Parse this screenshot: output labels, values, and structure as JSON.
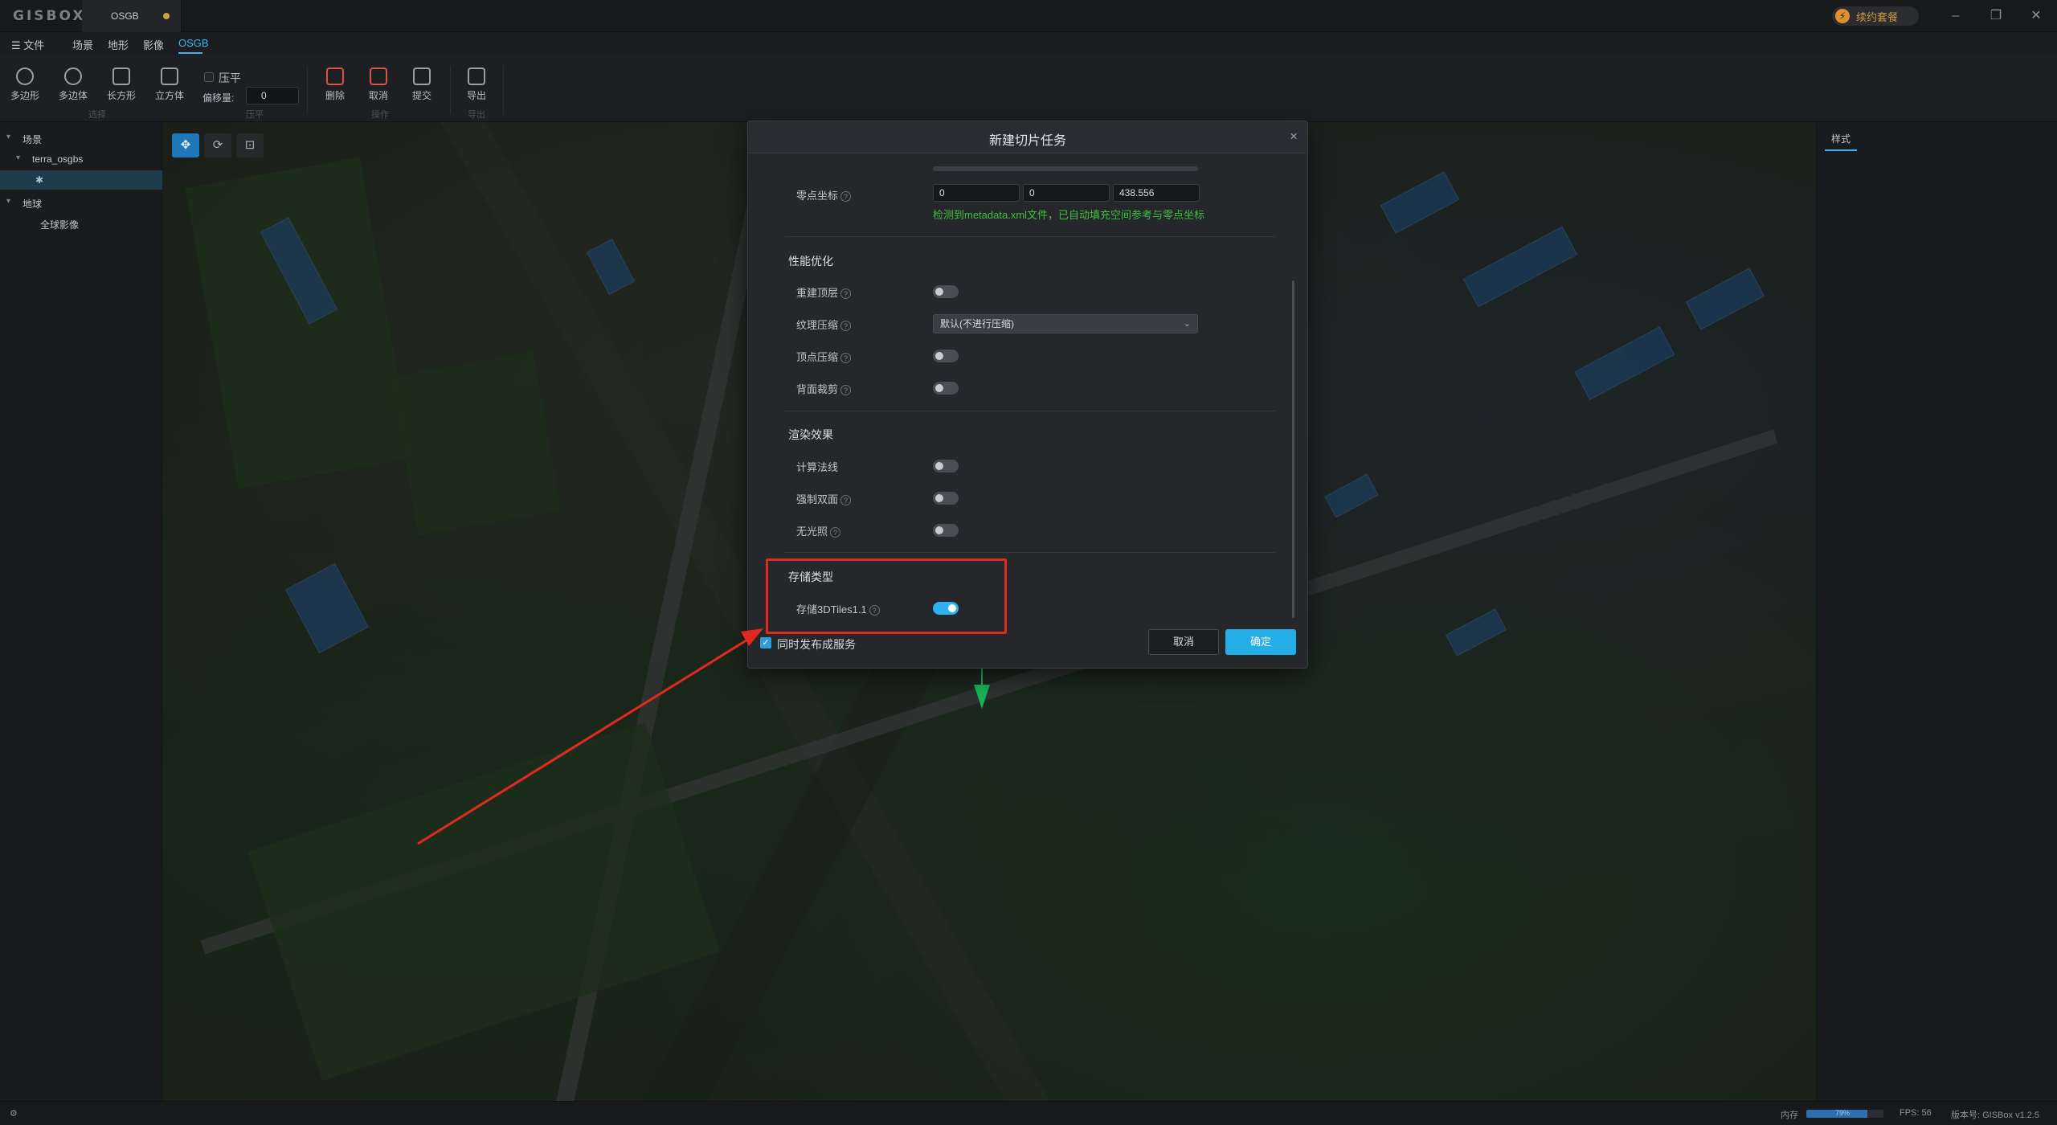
{
  "app": {
    "logo": "GISBOX",
    "doc_tab": "OSGB",
    "plan_label": "续约套餐",
    "plan_icon": "bolt-icon"
  },
  "window_buttons": {
    "minimize": "–",
    "restore": "❐",
    "close": "✕"
  },
  "menu": {
    "file": "☰ 文件",
    "items": [
      "场景",
      "地形",
      "影像",
      "OSGB"
    ],
    "active": "OSGB"
  },
  "toolbar": {
    "tools": [
      {
        "label": "多边形",
        "icon": "polygon-icon"
      },
      {
        "label": "多边体",
        "icon": "polyhedron-icon"
      },
      {
        "label": "长方形",
        "icon": "rectangle-icon"
      },
      {
        "label": "立方体",
        "icon": "cube-icon"
      },
      {
        "label": "删除",
        "icon": "trash-icon"
      },
      {
        "label": "取消",
        "icon": "cancel-icon"
      },
      {
        "label": "提交",
        "icon": "submit-icon"
      },
      {
        "label": "导出",
        "icon": "export-icon"
      }
    ],
    "flatten_label": "压平",
    "offset_label": "偏移量:",
    "offset_value": "0",
    "groups": [
      "选择",
      "压平",
      "操作",
      "导出"
    ]
  },
  "tree": {
    "scene": "场景",
    "layer": "terra_osgbs",
    "globe": "地球",
    "imagery": "全球影像"
  },
  "right_panel": {
    "tab": "样式"
  },
  "viewport_tools": [
    "✥",
    "⟳",
    "⊡"
  ],
  "status": {
    "memory_label": "内存",
    "memory_pct_text": "79%",
    "memory_fraction": 0.79,
    "fps": "FPS: 56",
    "version": "版本号: GISBox v1.2.5"
  },
  "modal": {
    "title": "新建切片任务",
    "close": "×",
    "origin_label": "零点坐标",
    "origin": [
      "0",
      "0",
      "438.556"
    ],
    "origin_hint": "检测到metadata.xml文件，已自动填充空间参考与零点坐标",
    "perf_title": "性能优化",
    "rebuild_top": "重建顶层",
    "texture_compress": "纹理压缩",
    "texture_option": "默认(不进行压缩)",
    "vertex_compress": "顶点压缩",
    "backface_cull": "背面裁剪",
    "render_title": "渲染效果",
    "compute_normals": "计算法线",
    "force_double": "强制双面",
    "no_light": "无光照",
    "storage_title": "存储类型",
    "storage_3dtiles": "存储3DTiles1.1",
    "publish_label": "同时发布成服务",
    "cancel": "取消",
    "ok": "确定"
  },
  "colors": {
    "accent": "#24aee8",
    "highlight": "#e02a20",
    "hint": "#3fbf3f"
  }
}
